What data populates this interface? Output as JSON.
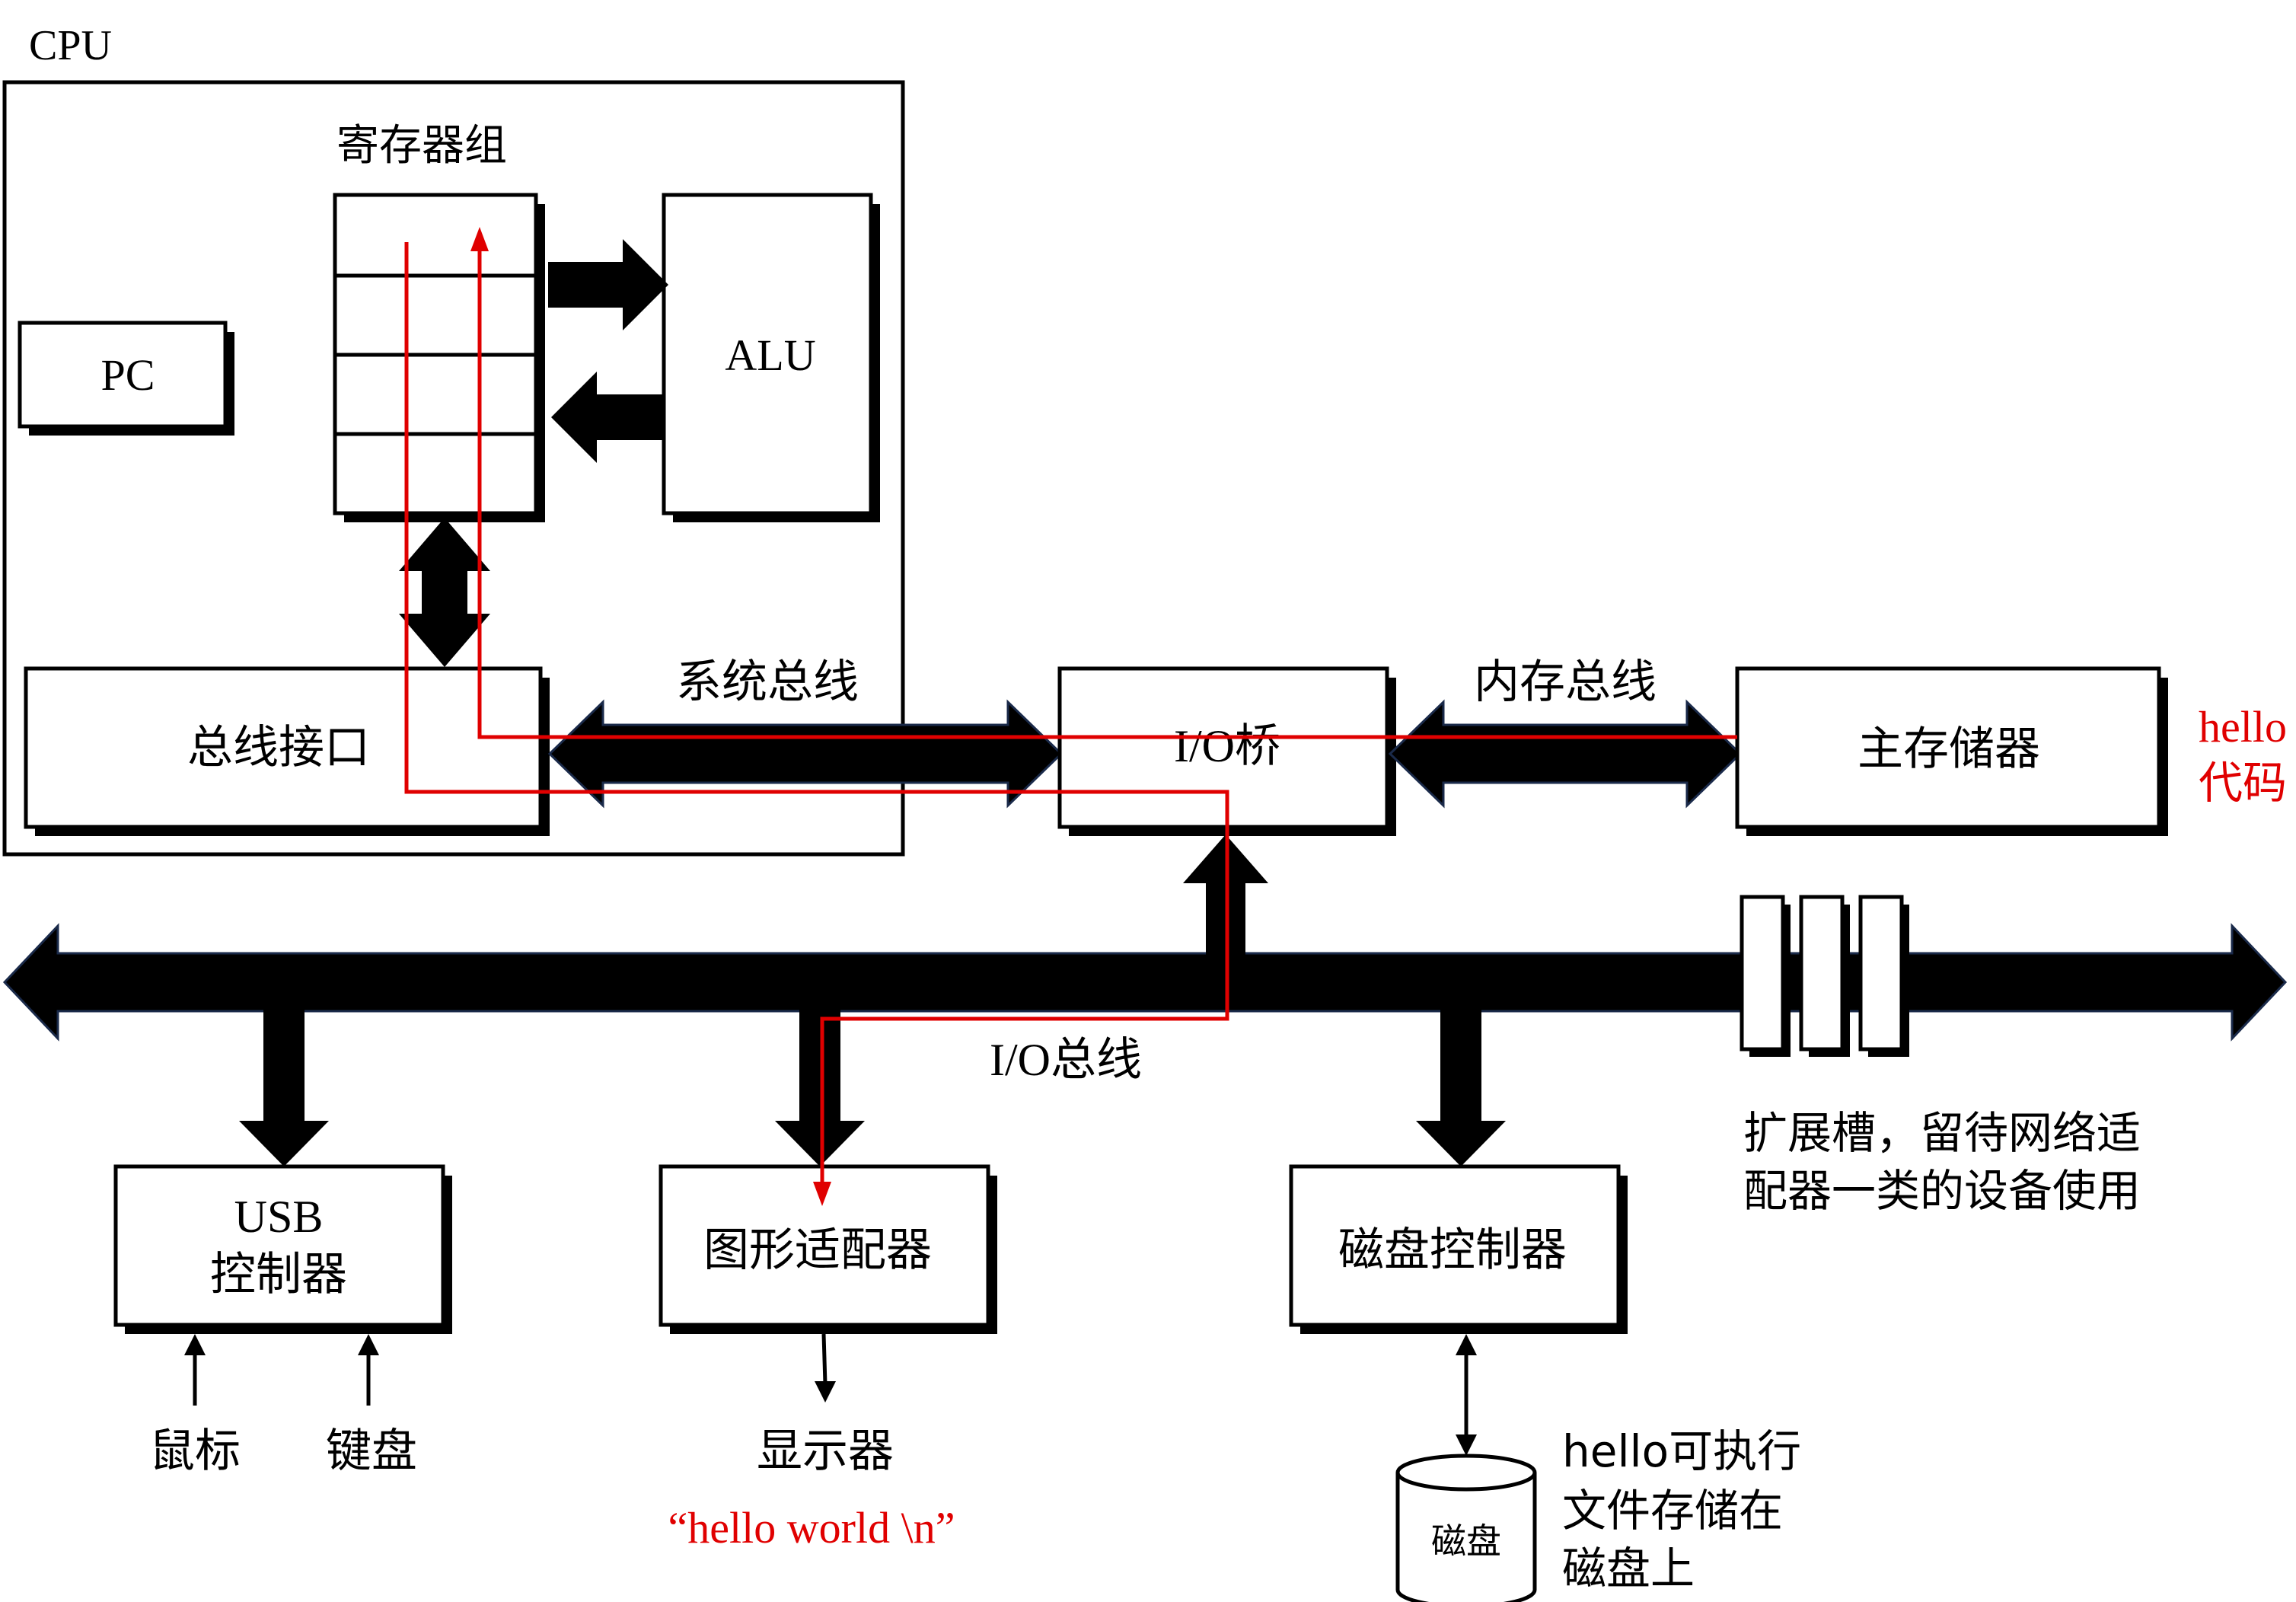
{
  "cpu": {
    "label": "CPU",
    "register_file_label": "寄存器组",
    "pc_label": "PC",
    "alu_label": "ALU",
    "bus_interface_label": "总线接口"
  },
  "buses": {
    "system_bus_label": "系统总线",
    "memory_bus_label": "内存总线",
    "io_bus_label": "I/O总线"
  },
  "components": {
    "io_bridge_label": "I/O桥",
    "main_memory_label": "主存储器",
    "usb_controller_line1": "USB",
    "usb_controller_line2": "控制器",
    "graphics_adapter_label": "图形适配器",
    "disk_controller_label": "磁盘控制器",
    "disk_label": "磁盘"
  },
  "peripherals": {
    "mouse_label": "鼠标",
    "keyboard_label": "键盘",
    "display_label": "显示器"
  },
  "annotations": {
    "hello_code_line1": "hello",
    "hello_code_line2": "代码",
    "hello_world_output": "“hello world \\n”",
    "expansion_slots_line1": "扩展槽，留待网络适",
    "expansion_slots_line2": "配器一类的设备使用",
    "disk_note_line1": "hello可执行",
    "disk_note_line2": "文件存储在",
    "disk_note_line3": "磁盘上"
  },
  "colors": {
    "data_path": "#e00000",
    "bus_fill": "#000000",
    "bus_outline": "#1a2a4a",
    "annotation_red": "#e00000"
  }
}
